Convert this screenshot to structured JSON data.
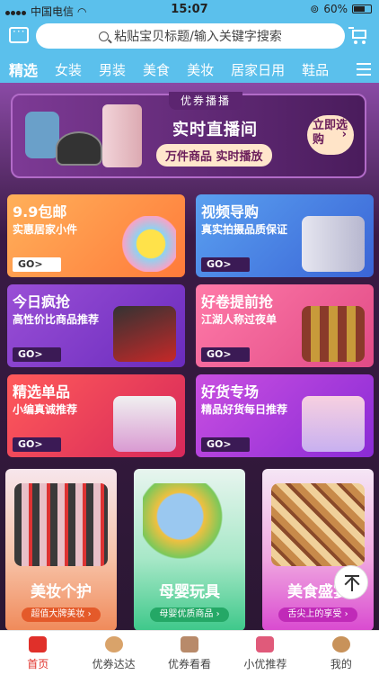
{
  "status_bar": {
    "carrier": "中国电信",
    "time": "15:07",
    "battery": "60%"
  },
  "header": {
    "search_placeholder": "粘贴宝贝标题/输入关键字搜索"
  },
  "category_tabs": [
    "精选",
    "女装",
    "男装",
    "美食",
    "美妆",
    "居家日用",
    "鞋品"
  ],
  "live_banner": {
    "tag": "优券播播",
    "title": "实时直播间",
    "subtitle": "万件商品 实时播放",
    "button": "立即选购"
  },
  "tiles": [
    {
      "title": "9.9包邮",
      "subtitle": "实惠居家小件",
      "go": "GO>"
    },
    {
      "title": "视频导购",
      "subtitle": "真实拍摄品质保证",
      "go": "GO>"
    },
    {
      "title": "今日疯抢",
      "subtitle": "高性价比商品推荐",
      "go": "GO>"
    },
    {
      "title": "好卷提前抢",
      "subtitle": "江湖人称过夜单",
      "go": "GO>"
    },
    {
      "title": "精选单品",
      "subtitle": "小编真诚推荐",
      "go": "GO>"
    },
    {
      "title": "好货专场",
      "subtitle": "精品好货每日推荐",
      "go": "GO>"
    }
  ],
  "cards": [
    {
      "title": "美妆个护",
      "subtitle": "超值大牌美妆 ›"
    },
    {
      "title": "母婴玩具",
      "subtitle": "母婴优质商品 ›"
    },
    {
      "title": "美食盛宴",
      "subtitle": "舌尖上的享受 ›"
    }
  ],
  "bottom_nav": [
    {
      "label": "首页",
      "active": true
    },
    {
      "label": "优券达达",
      "active": false
    },
    {
      "label": "优券看看",
      "active": false
    },
    {
      "label": "小优推荐",
      "active": false
    },
    {
      "label": "我的",
      "active": false
    }
  ]
}
